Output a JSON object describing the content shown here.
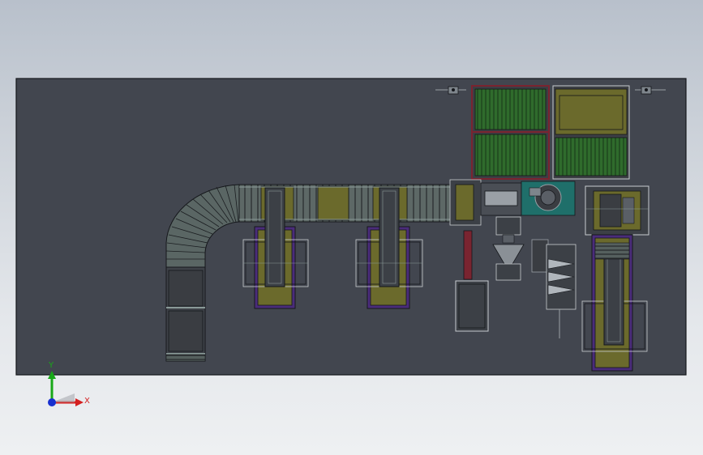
{
  "colors": {
    "background_top": "#b8c0cb",
    "background_bottom": "#eef0f2",
    "floor_plate": "#42464f",
    "outline": "#15171b",
    "conveyor_roller": "#6b7a78",
    "olive_panel": "#6b6a2c",
    "green_slats": "#2f6b2c",
    "purple_frame": "#4a2c7a",
    "maroon_frame": "#7a2430",
    "teal_cell": "#1f6f6a",
    "axis_x": "#d42020",
    "axis_y": "#18a818",
    "axis_z": "#1830d0"
  },
  "icons": {
    "triad": "coordinate-triad-icon",
    "fan_left": "fan-unit-icon",
    "fan_right": "fan-unit-icon"
  },
  "triad": {
    "x_label": "X",
    "y_label": "Y"
  }
}
